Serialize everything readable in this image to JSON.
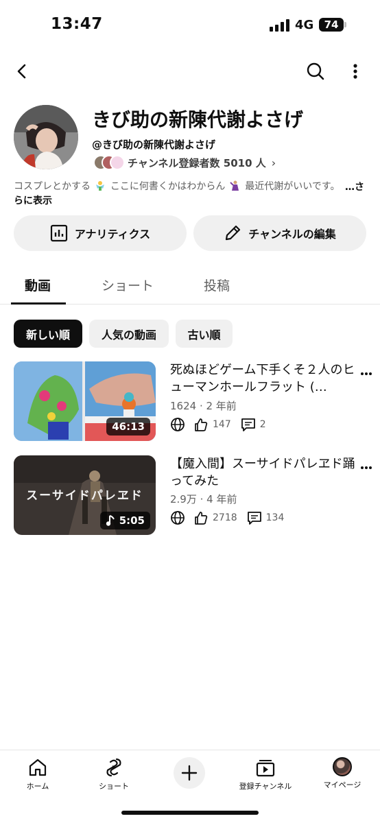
{
  "status_bar": {
    "time": "13:47",
    "network": "4G",
    "battery": "74"
  },
  "top_bar": {
    "back_icon": "back-arrow-icon",
    "search_icon": "search-icon",
    "more_icon": "more-vert-icon"
  },
  "channel": {
    "name": "きび助の新陳代謝よさげ",
    "handle": "@きび助の新陳代謝よさげ",
    "subscribers": "チャンネル登録者数 5010 人",
    "description_before_emoji1": "コスプレとかする",
    "description_middle": "ここに何書くかはわからん",
    "description_after_emoji2": "最近代謝がいいです。",
    "more_part1": "…さ",
    "more_part2": "らに表示"
  },
  "actions": {
    "analytics": "アナリティクス",
    "edit": "チャンネルの編集"
  },
  "tabs": [
    {
      "label": "動画",
      "active": true
    },
    {
      "label": "ショート",
      "active": false
    },
    {
      "label": "投稿",
      "active": false
    }
  ],
  "chips": [
    {
      "label": "新しい順",
      "selected": true
    },
    {
      "label": "人気の動画",
      "selected": false
    },
    {
      "label": "古い順",
      "selected": false
    }
  ],
  "videos": [
    {
      "title": "死ぬほどゲーム下手くそ２人のヒューマンホールフラット (…",
      "meta": "1624 · 2 年前",
      "likes": "147",
      "comments": "2",
      "duration": "46:13",
      "is_short": false,
      "thumb_text": ""
    },
    {
      "title": "【魔入間】スーサイドパレヱド踊ってみた",
      "meta": "2.9万 · 4 年前",
      "likes": "2718",
      "comments": "134",
      "duration": "5:05",
      "is_short": true,
      "thumb_text": "スーサイドパレヱド"
    }
  ],
  "bottom_nav": [
    {
      "label": "ホーム",
      "icon": "home-icon"
    },
    {
      "label": "ショート",
      "icon": "shorts-icon"
    },
    {
      "label": "",
      "icon": "plus-icon"
    },
    {
      "label": "登録チャンネル",
      "icon": "subscriptions-icon"
    },
    {
      "label": "マイページ",
      "icon": "avatar-icon"
    }
  ],
  "colors": {
    "text": "#0f0f0f",
    "secondary": "#606060",
    "chip_bg": "#f0f0f0",
    "selected_chip": "#0f0f0f"
  }
}
